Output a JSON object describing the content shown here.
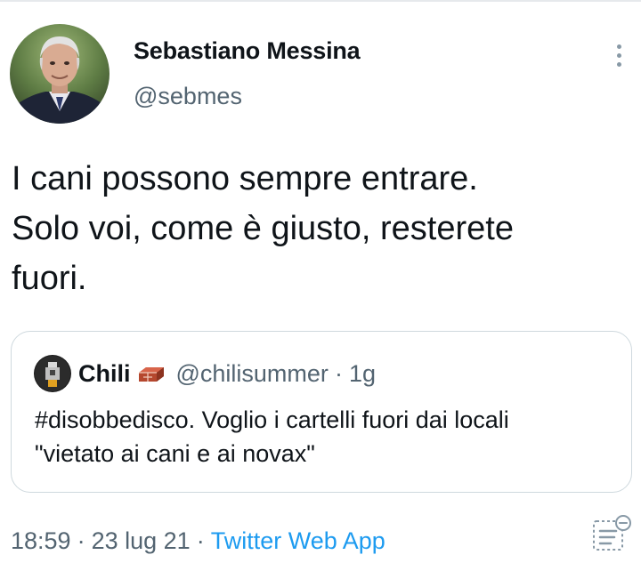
{
  "tweet": {
    "author": {
      "display_name": "Sebastiano Messina",
      "handle": "@sebmes",
      "avatar_icon": "profile-photo"
    },
    "more_icon": "vertical-ellipsis-icon",
    "text": "I cani possono sempre entrare.\nSolo voi, come è giusto, resterete\nfuori.",
    "quoted": {
      "author": {
        "display_name": "Chili",
        "emoji_icon": "brick-icon",
        "handle": "@chilisummer",
        "separator": "·",
        "time": "1g"
      },
      "text": "#disobbedisco. Voglio i cartelli fuori dai locali\n\"vietato ai cani e ai novax\""
    },
    "meta": {
      "time": "18:59",
      "separator": "·",
      "date": "23 lug 21",
      "source": "Twitter Web App",
      "analytics_icon": "analytics-icon"
    }
  },
  "colors": {
    "text_primary": "#0f1419",
    "text_secondary": "#536471",
    "link": "#1d9bf0",
    "border": "#cfd9de"
  }
}
